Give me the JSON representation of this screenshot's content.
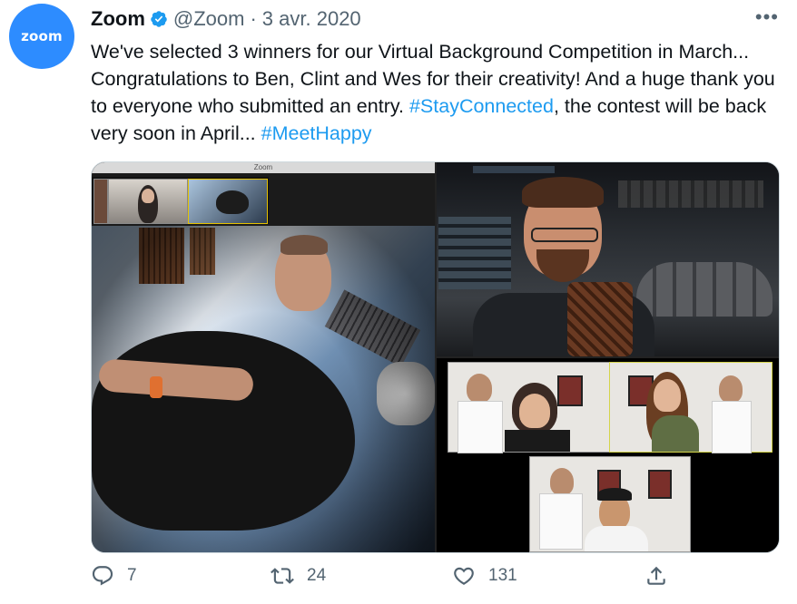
{
  "avatar": {
    "text": "zoom",
    "color": "#2d8cff"
  },
  "header": {
    "name": "Zoom",
    "handle": "@Zoom",
    "separator": "·",
    "date": "3 avr. 2020",
    "more_icon": "more-horizontal-icon"
  },
  "tweet": {
    "text": "We've selected 3 winners for our Virtual Background Competition in March... Congratulations to Ben, Clint and Wes for their creativity! And a huge thank you to everyone who submitted an entry. ",
    "hashtag1": "#StayConnected",
    "text2": ", the contest will be back very soon in April... ",
    "hashtag2": "#MeetHappy"
  },
  "media": {
    "left_window_title": "Zoom"
  },
  "actions": {
    "reply_count": "7",
    "retweet_count": "24",
    "like_count": "131"
  },
  "colors": {
    "link": "#1d9bf0",
    "muted": "#536471",
    "text": "#0f1419"
  }
}
